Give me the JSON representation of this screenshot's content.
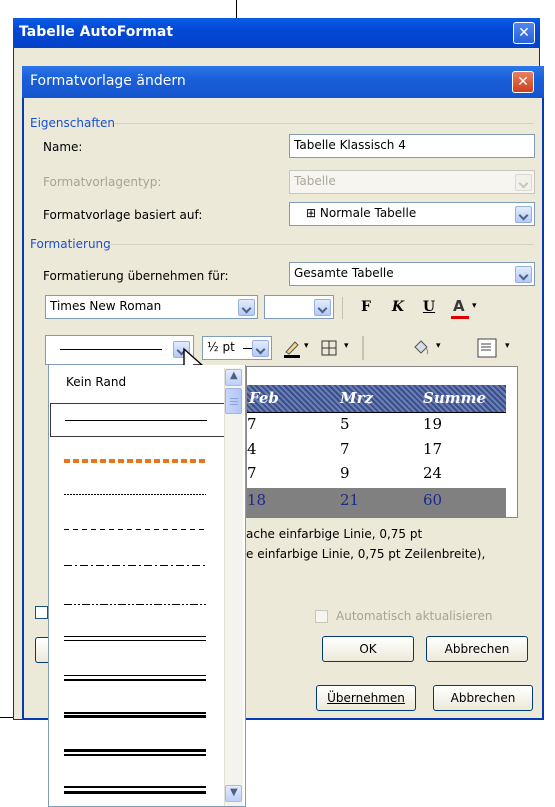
{
  "outer_dialog": {
    "title": "Tabelle AutoFormat",
    "close_glyph": "✕"
  },
  "inner_dialog": {
    "title": "Formatvorlage ändern",
    "close_glyph": "✕"
  },
  "properties": {
    "group_label": "Eigenschaften",
    "name_label": "Name:",
    "name_value": "Tabelle Klassisch 4",
    "type_label": "Formatvorlagentyp:",
    "type_value": "Tabelle",
    "based_on_label": "Formatvorlage basiert auf:",
    "based_on_value": "⊞ Normale Tabelle"
  },
  "formatting": {
    "group_label": "Formatierung",
    "apply_to_label": "Formatierung übernehmen für:",
    "apply_to_value": "Gesamte Tabelle",
    "font_value": "Times New Roman",
    "size_value": "",
    "bold": "F",
    "italic": "K",
    "underline": "U",
    "font_color": "A",
    "line_weight": "½ pt",
    "accent_red": "#e00000"
  },
  "preview": {
    "header": [
      "Feb",
      "Mrz",
      "Summe"
    ],
    "rows": [
      [
        "7",
        "5",
        "19"
      ],
      [
        "4",
        "7",
        "17"
      ],
      [
        "7",
        "9",
        "24"
      ]
    ],
    "total_row": [
      "18",
      "21",
      "60"
    ],
    "description_line1": "ache einfarbige Linie,  0,75 pt",
    "description_line2": "e einfarbige Linie,  0,75 pt Zeilenbreite),"
  },
  "border_list": {
    "first_item": "Kein Rand",
    "selected_index": 1,
    "highlight_color": "#e8761c"
  },
  "checkbox_auto_update": "Automatisch aktualisieren",
  "inner_buttons": {
    "ok": "OK",
    "cancel": "Abbrechen"
  },
  "outer_buttons": {
    "apply": "Übernehmen",
    "cancel": "Abbrechen"
  }
}
